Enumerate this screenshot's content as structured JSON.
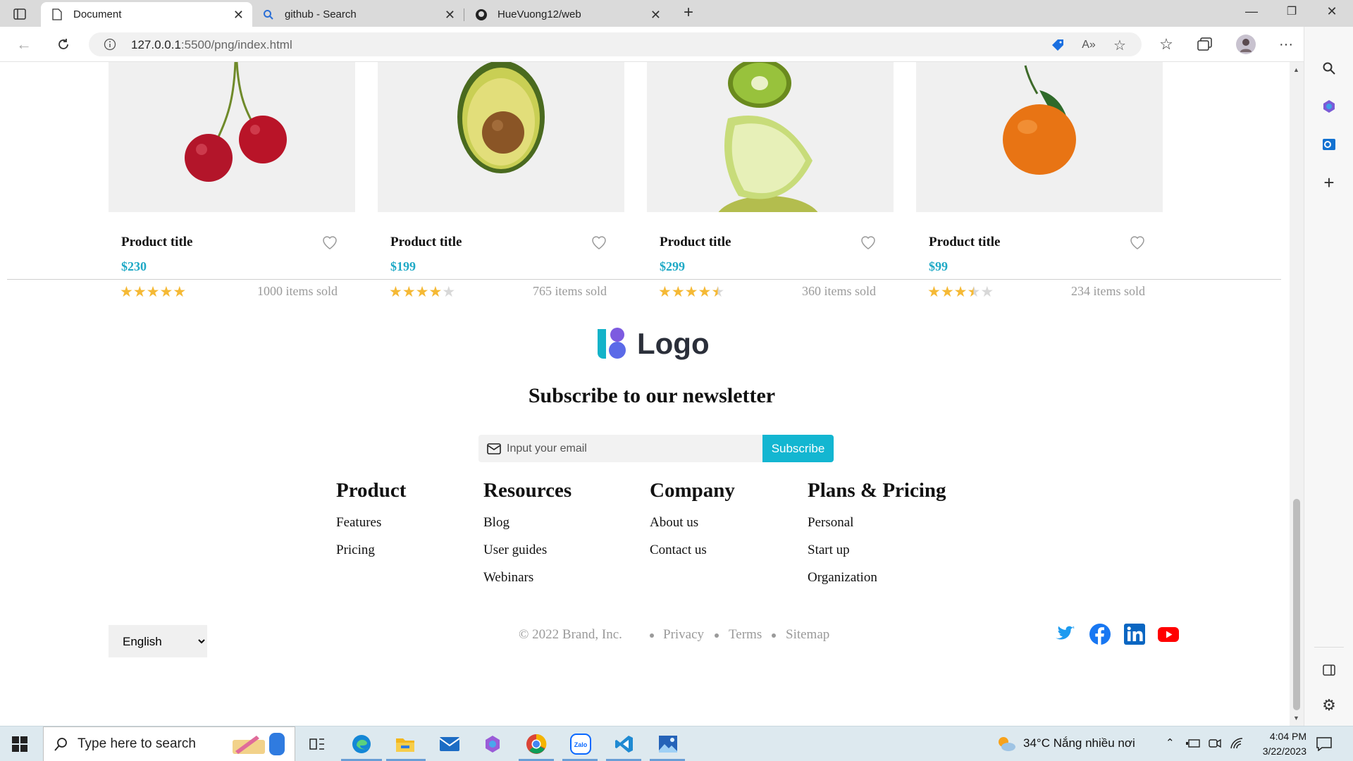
{
  "browser": {
    "tabs": [
      {
        "title": "Document",
        "icon": "document-icon"
      },
      {
        "title": "github - Search",
        "icon": "search-icon"
      },
      {
        "title": "HueVuong12/web",
        "icon": "github-icon"
      }
    ],
    "url_host": "127.0.0.1",
    "url_path": ":5500/png/index.html"
  },
  "products": [
    {
      "title": "Product title",
      "price": "$230",
      "rating": 5,
      "sold": "1000 items sold",
      "fruit": "cherry"
    },
    {
      "title": "Product title",
      "price": "$199",
      "rating": 4,
      "sold": "765 items sold",
      "fruit": "avocado"
    },
    {
      "title": "Product title",
      "price": "$299",
      "rating": 4.5,
      "sold": "360 items sold",
      "fruit": "kiwi-lime"
    },
    {
      "title": "Product title",
      "price": "$99",
      "rating": 3.5,
      "sold": "234 items sold",
      "fruit": "tangerine"
    }
  ],
  "footer": {
    "logo_text": "Logo",
    "newsletter_title": "Subscribe to our newsletter",
    "email_placeholder": "Input your email",
    "subscribe_label": "Subscribe",
    "columns": [
      {
        "heading": "Product",
        "links": [
          "Features",
          "Pricing"
        ]
      },
      {
        "heading": "Resources",
        "links": [
          "Blog",
          "User guides",
          "Webinars"
        ]
      },
      {
        "heading": "Company",
        "links": [
          "About us",
          "Contact us"
        ]
      },
      {
        "heading": "Plans & Pricing",
        "links": [
          "Personal",
          "Start up",
          "Organization"
        ]
      }
    ],
    "language": "English",
    "copyright": "© 2022 Brand, Inc.",
    "legal_links": [
      "Privacy",
      "Terms",
      "Sitemap"
    ],
    "social": [
      "twitter-icon",
      "facebook-icon",
      "linkedin-icon",
      "youtube-icon"
    ]
  },
  "taskbar": {
    "search_placeholder": "Type here to search",
    "weather": "34°C  Nắng nhiều nơi",
    "time": "4:04 PM",
    "date": "3/22/2023"
  },
  "colors": {
    "accent": "#13b6d1",
    "price": "#1fa9c6",
    "star": "#f5b935"
  }
}
